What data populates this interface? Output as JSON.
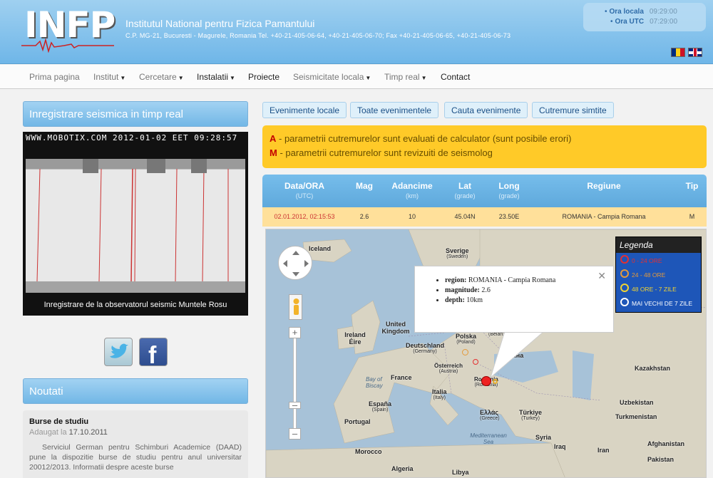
{
  "header": {
    "logo_text": "INFP",
    "title": "Institutul National pentru Fizica Pamantului",
    "address": "C.P. MG-21, Bucuresti - Magurele, Romania Tel. +40-21-405-06-64, +40-21-405-06-70; Fax +40-21-405-06-65, +40-21-405-06-73",
    "clock": {
      "local_label": "Ora locala",
      "local_value": "09:29:00",
      "utc_label": "Ora UTC",
      "utc_value": "07:29:00"
    }
  },
  "nav": {
    "items": [
      "Prima pagina",
      "Institut",
      "Cercetare",
      "Instalatii",
      "Proiecte",
      "Seismicitate locala",
      "Timp real",
      "Contact"
    ]
  },
  "left": {
    "realtime_title": "Inregistrare seismica in timp real",
    "cam_stamp": "WWW.MOBOTIX.COM  2012-01-02 EET 09:28:57",
    "cam_caption": "Inregistrare de la observatorul seismic Muntele Rosu",
    "news_title": "Noutati",
    "news": {
      "title": "Burse de studiu",
      "added_label": "Adaugat la",
      "added_date": "17.10.2011",
      "body": "Serviciul German pentru Schimburi Academice (DAAD) pune la dispozitie burse de studiu pentru anul universitar 20012/2013. Informatii despre aceste burse"
    }
  },
  "tabs": [
    "Evenimente locale",
    "Toate evenimentele",
    "Cauta evenimente",
    "Cutremure simtite"
  ],
  "notice": {
    "a_letter": "A",
    "a_text": " - parametrii cutremurelor sunt evaluati de calculator (sunt posibile erori)",
    "m_letter": "M",
    "m_text": " - parametrii cutremurelor sunt revizuiti de seismolog"
  },
  "table": {
    "headers": {
      "date": "Data/ORA",
      "date_sub": "(UTC)",
      "mag": "Mag",
      "depth": "Adancime",
      "depth_sub": "(km)",
      "lat": "Lat",
      "lat_sub": "(grade)",
      "lon": "Long",
      "lon_sub": "(grade)",
      "region": "Regiune",
      "type": "Tip"
    },
    "row": {
      "date": "02.01.2012, 02:15:53",
      "mag": "2.6",
      "depth": "10",
      "lat": "45.04N",
      "lon": "23.50E",
      "region": "ROMANIA - Campia Romana",
      "type": "M"
    }
  },
  "map": {
    "labels": {
      "iceland": "Iceland",
      "sverige": "Sverige",
      "sverige_sub": "(Sweden)",
      "uk": "United Kingdom",
      "ireland": "Ireland Éire",
      "deutschland": "Deutschland",
      "deutschland_sub": "(Germany)",
      "polska": "Polska",
      "polska_sub": "(Poland)",
      "belarus": "(Belarus)",
      "osterreich": "Österreich",
      "osterreich_sub": "(Austria)",
      "romania": "România",
      "romania_sub": "(Romania)",
      "ukraina": "Україна",
      "france": "France",
      "italia": "Italia",
      "italia_sub": "(Italy)",
      "espana": "España",
      "espana_sub": "(Spain)",
      "portugal": "Portugal",
      "ellas": "Ελλάς",
      "ellas_sub": "(Greece)",
      "turkiye": "Türkiye",
      "turkiye_sub": "(Turkey)",
      "kazakhstan": "Kazakhstan",
      "uzbekistan": "Uzbekistan",
      "turkmenistan": "Turkmenistan",
      "syria": "Syria",
      "iraq": "Iraq",
      "iran": "Iran",
      "afghanistan": "Afghanistan",
      "pakistan": "Pakistan",
      "morocco": "Morocco",
      "algeria": "Algeria",
      "libya": "Libya",
      "bay_biscay": "Bay of Biscay",
      "med_sea": "Mediterranean Sea"
    },
    "popup": {
      "region_label": "region:",
      "region": "ROMANIA - Campia Romana",
      "magnitude_label": "magnitude:",
      "magnitude": "2.6",
      "depth_label": "depth:",
      "depth": "10km"
    },
    "legend": {
      "title": "Legenda",
      "items": [
        "0 - 24 ORE",
        "24 - 48 ORE",
        "48 ORE - 7 ZILE",
        "MAI VECHI DE 7 ZILE"
      ],
      "colors": [
        "#e53030",
        "#e49a3a",
        "#f2d431",
        "#ffffff"
      ]
    }
  }
}
